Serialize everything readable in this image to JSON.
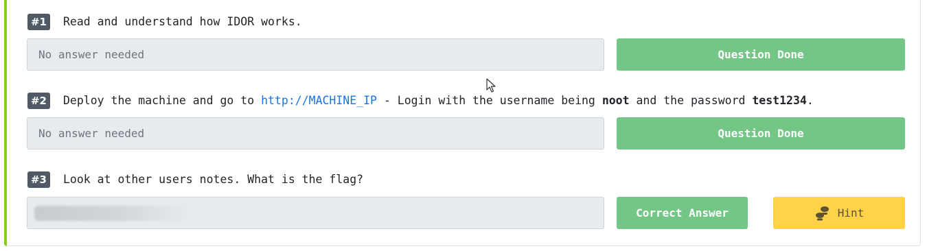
{
  "questions": [
    {
      "number": "#1",
      "text": "Read and understand how IDOR works.",
      "answer_placeholder": "No answer needed",
      "button_label": "Question Done"
    },
    {
      "number": "#2",
      "text_before_link": "Deploy the machine and go to ",
      "link_text": "http://MACHINE_IP",
      "text_after_link": " - Login with the username being ",
      "username": "noot",
      "text_middle": " and the password ",
      "password": "test1234",
      "text_end": ".",
      "answer_placeholder": "No answer needed",
      "button_label": "Question Done"
    },
    {
      "number": "#3",
      "text": "Look at other users notes. What is the flag?",
      "answer_value": "",
      "button_label": "Correct Answer",
      "hint_label": "Hint",
      "hint_icon": "footsteps-icon"
    }
  ],
  "colors": {
    "accent_border": "#88cc14",
    "done_button": "#74c686",
    "hint_button": "#ffd24a",
    "link": "#1a73e8",
    "question_badge": "#505a64"
  }
}
